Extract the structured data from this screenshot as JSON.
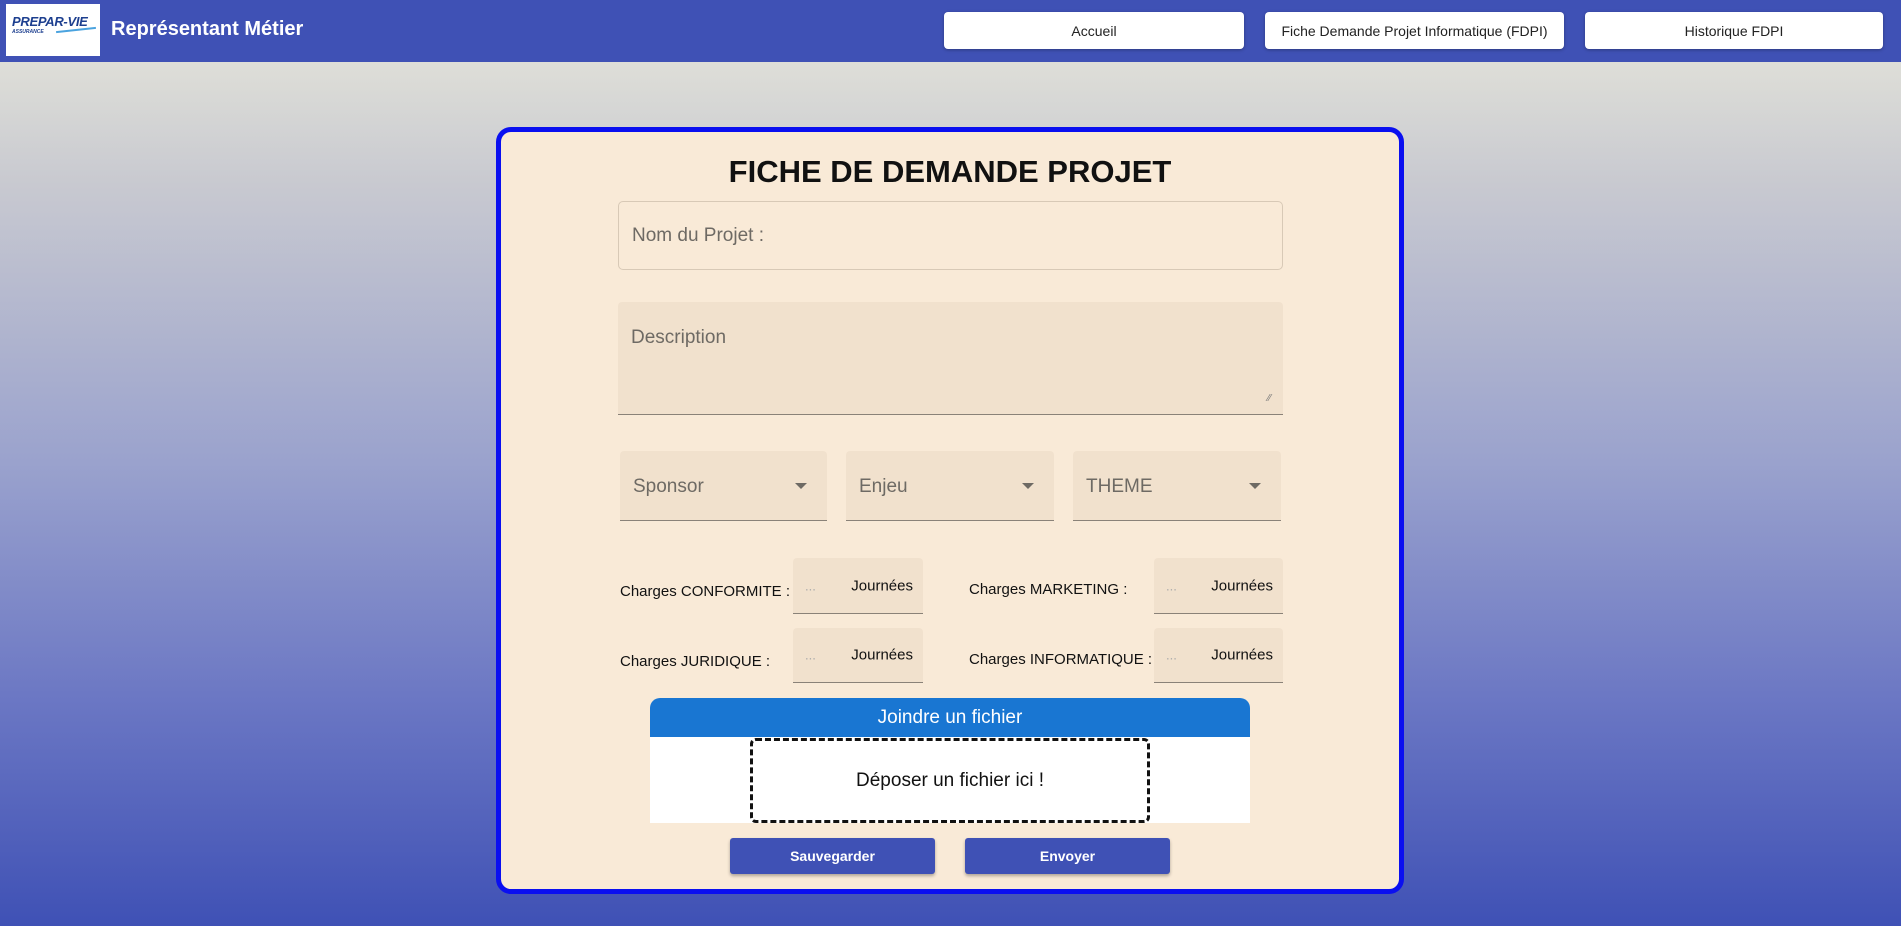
{
  "header": {
    "logo_text": "PREPAR-VIE",
    "logo_subtext": "ASSURANCE",
    "title": "Représentant Métier",
    "nav": [
      "Accueil",
      "Fiche Demande Projet Informatique (FDPI)",
      "Historique FDPI"
    ]
  },
  "form": {
    "title": "FICHE DE DEMANDE PROJET",
    "project_name_label": "Nom du Projet :",
    "description_label": "Description",
    "selects": [
      "Sponsor",
      "Enjeu",
      "THEME"
    ],
    "charges": [
      {
        "label": "Charges CONFORMITE :",
        "placeholder": "...",
        "unit": "Journées"
      },
      {
        "label": "Charges MARKETING :",
        "placeholder": "...",
        "unit": "Journées"
      },
      {
        "label": "Charges JURIDIQUE :",
        "placeholder": "...",
        "unit": "Journées"
      },
      {
        "label": "Charges INFORMATIQUE :",
        "placeholder": "...",
        "unit": "Journées"
      }
    ],
    "attach_title": "Joindre un fichier",
    "drop_text": "Déposer un fichier ici !",
    "save_label": "Sauvegarder",
    "send_label": "Envoyer"
  }
}
